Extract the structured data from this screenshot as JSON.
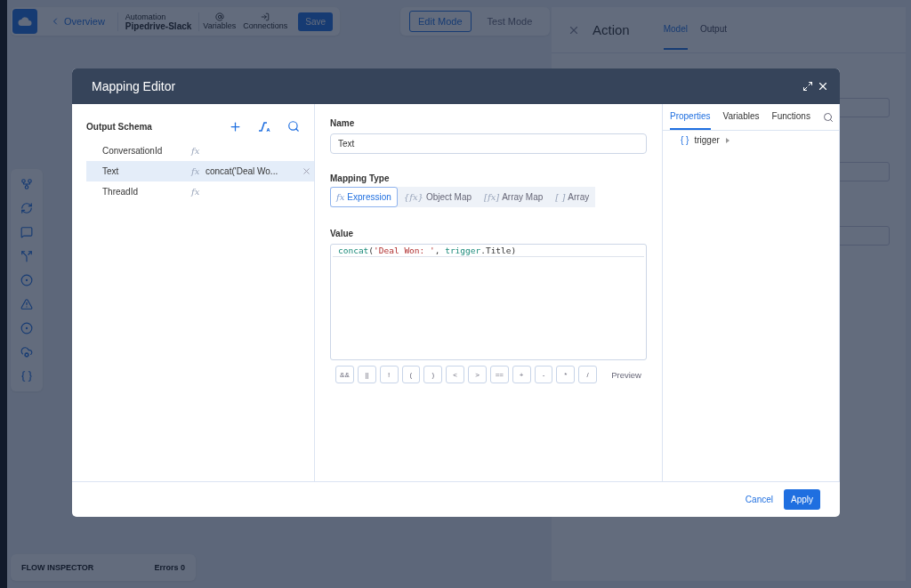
{
  "app_bar": {
    "back": "Overview",
    "automation_label": "Automation",
    "automation_name": "Pipedrive-Slack",
    "tools": [
      {
        "label": "Variables",
        "kind": "at"
      },
      {
        "label": "Connections",
        "kind": "connect"
      }
    ],
    "save": "Save",
    "modes": [
      {
        "label": "Edit Mode",
        "selected": true
      },
      {
        "label": "Test Mode",
        "selected": false
      }
    ]
  },
  "side_panel": {
    "title": "Action",
    "tabs": [
      {
        "label": "Model",
        "selected": true
      },
      {
        "label": "Output",
        "selected": false
      }
    ]
  },
  "flow_inspector": {
    "title": "FLOW INSPECTOR",
    "errors_label": "Errors",
    "errors_count": "0"
  },
  "modal": {
    "title": "Mapping Editor",
    "schema": {
      "title": "Output Schema",
      "fields": [
        {
          "name": "ConversationId",
          "icon": "fx",
          "selected": false
        },
        {
          "name": "Text",
          "icon": "fx",
          "expression": "concat('Deal Wo...",
          "selected": true
        },
        {
          "name": "ThreadId",
          "icon": "fx",
          "selected": false
        }
      ]
    },
    "name_label": "Name",
    "name_value": "Text",
    "mapping_type_label": "Mapping Type",
    "mapping_types": [
      {
        "icon": "fx",
        "label": "Expression",
        "selected": true
      },
      {
        "icon": "{fx}",
        "label": "Object Map",
        "selected": false
      },
      {
        "icon": "[fx]",
        "label": "Array Map",
        "selected": false
      },
      {
        "icon": "[ ]",
        "label": "Array",
        "selected": false
      }
    ],
    "value_label": "Value",
    "code": [
      {
        "text": "concat",
        "kind": "function"
      },
      {
        "text": "(",
        "kind": "plain"
      },
      {
        "text": "'Deal Won: '",
        "kind": "string"
      },
      {
        "text": ", ",
        "kind": "plain"
      },
      {
        "text": "trigger",
        "kind": "function"
      },
      {
        "text": ".Title)",
        "kind": "plain"
      }
    ],
    "operators": [
      "&&",
      "||",
      "!",
      "(",
      ")",
      "<",
      ">",
      "==",
      "+",
      "-",
      "*",
      "/"
    ],
    "preview": "Preview",
    "right_tabs": [
      {
        "label": "Properties",
        "selected": true
      },
      {
        "label": "Variables",
        "selected": false
      },
      {
        "label": "Functions",
        "selected": false
      }
    ],
    "tree": [
      {
        "icon": "{ }",
        "label": "trigger",
        "expanded": false
      }
    ],
    "cancel": "Cancel",
    "apply": "Apply"
  }
}
